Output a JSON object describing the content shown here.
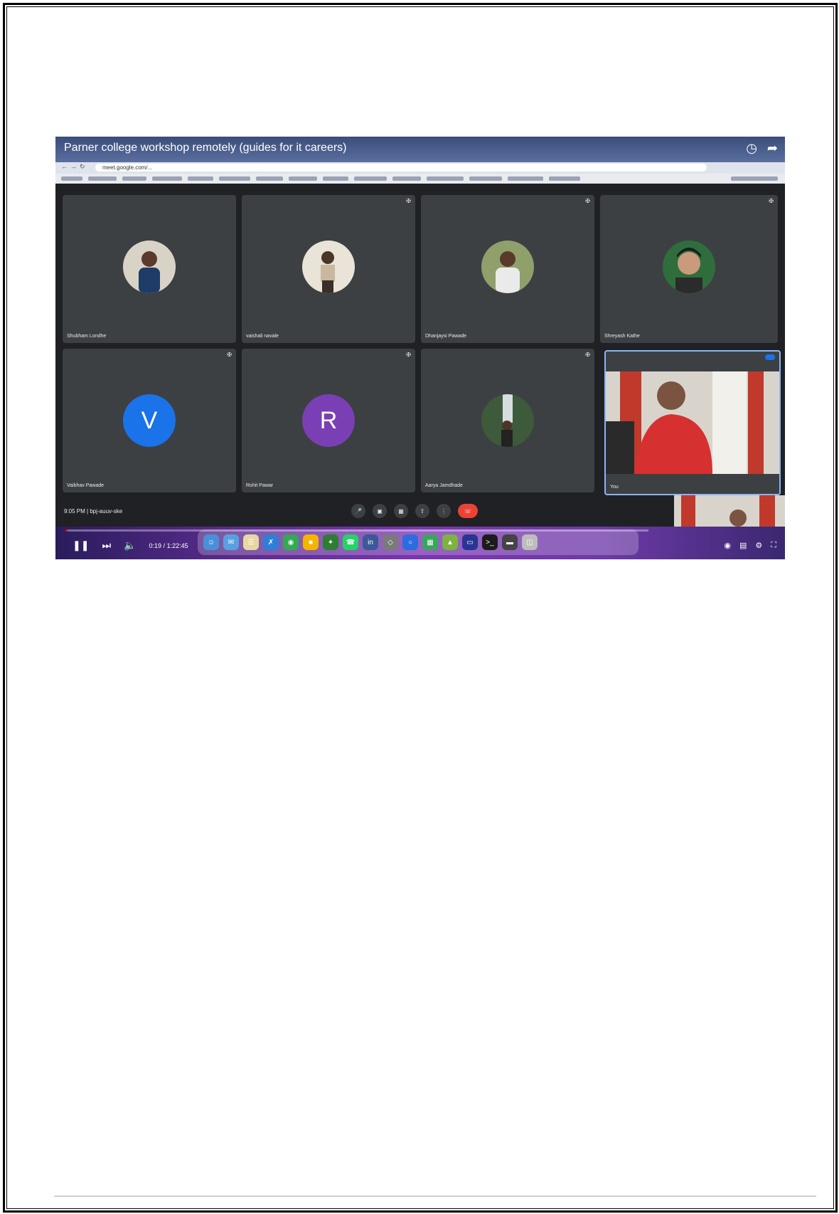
{
  "video": {
    "title": "Parner college workshop remotely (guides for it careers)",
    "current_time": "0:19",
    "duration": "1:22:45",
    "time_separator": " / ",
    "progress_fraction": 0.004
  },
  "browser": {
    "url": "meet.google.com/..."
  },
  "meeting": {
    "participants": [
      {
        "name": "Shubham Londhe",
        "avatar": "photo"
      },
      {
        "name": "vaishali navale",
        "avatar": "photo"
      },
      {
        "name": "Dhanjaysi Pawade",
        "avatar": "photo"
      },
      {
        "name": "Shreyash Kathe",
        "avatar": "photo"
      },
      {
        "name": "Vaibhav Pawade",
        "avatar": "letter",
        "letter": "V",
        "color": "#1a73e8"
      },
      {
        "name": "Rohit Pawar",
        "avatar": "letter",
        "letter": "R",
        "color": "#7b3fb5"
      },
      {
        "name": "Aarya Jamdhade",
        "avatar": "photo"
      }
    ],
    "self_name": "You",
    "footer_time": "9:05 PM",
    "meeting_code": "bpj-auuv-ske"
  },
  "colors": {
    "meet_bg": "#202124",
    "tile_bg": "#3c4043",
    "hangup": "#ea4335",
    "self_border": "#8ab4f8"
  }
}
